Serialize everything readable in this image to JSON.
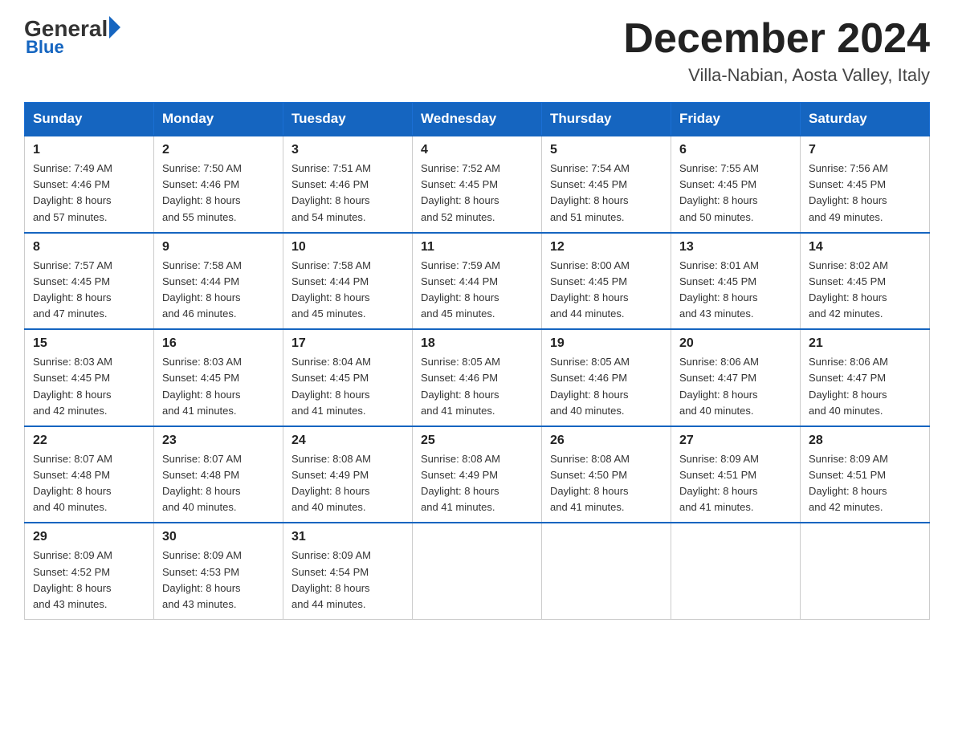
{
  "header": {
    "logo_general": "General",
    "logo_blue": "Blue",
    "month_title": "December 2024",
    "location": "Villa-Nabian, Aosta Valley, Italy"
  },
  "weekdays": [
    "Sunday",
    "Monday",
    "Tuesday",
    "Wednesday",
    "Thursday",
    "Friday",
    "Saturday"
  ],
  "weeks": [
    [
      {
        "day": 1,
        "sunrise": "7:49 AM",
        "sunset": "4:46 PM",
        "daylight": "8 hours and 57 minutes."
      },
      {
        "day": 2,
        "sunrise": "7:50 AM",
        "sunset": "4:46 PM",
        "daylight": "8 hours and 55 minutes."
      },
      {
        "day": 3,
        "sunrise": "7:51 AM",
        "sunset": "4:46 PM",
        "daylight": "8 hours and 54 minutes."
      },
      {
        "day": 4,
        "sunrise": "7:52 AM",
        "sunset": "4:45 PM",
        "daylight": "8 hours and 52 minutes."
      },
      {
        "day": 5,
        "sunrise": "7:54 AM",
        "sunset": "4:45 PM",
        "daylight": "8 hours and 51 minutes."
      },
      {
        "day": 6,
        "sunrise": "7:55 AM",
        "sunset": "4:45 PM",
        "daylight": "8 hours and 50 minutes."
      },
      {
        "day": 7,
        "sunrise": "7:56 AM",
        "sunset": "4:45 PM",
        "daylight": "8 hours and 49 minutes."
      }
    ],
    [
      {
        "day": 8,
        "sunrise": "7:57 AM",
        "sunset": "4:45 PM",
        "daylight": "8 hours and 47 minutes."
      },
      {
        "day": 9,
        "sunrise": "7:58 AM",
        "sunset": "4:44 PM",
        "daylight": "8 hours and 46 minutes."
      },
      {
        "day": 10,
        "sunrise": "7:58 AM",
        "sunset": "4:44 PM",
        "daylight": "8 hours and 45 minutes."
      },
      {
        "day": 11,
        "sunrise": "7:59 AM",
        "sunset": "4:44 PM",
        "daylight": "8 hours and 45 minutes."
      },
      {
        "day": 12,
        "sunrise": "8:00 AM",
        "sunset": "4:45 PM",
        "daylight": "8 hours and 44 minutes."
      },
      {
        "day": 13,
        "sunrise": "8:01 AM",
        "sunset": "4:45 PM",
        "daylight": "8 hours and 43 minutes."
      },
      {
        "day": 14,
        "sunrise": "8:02 AM",
        "sunset": "4:45 PM",
        "daylight": "8 hours and 42 minutes."
      }
    ],
    [
      {
        "day": 15,
        "sunrise": "8:03 AM",
        "sunset": "4:45 PM",
        "daylight": "8 hours and 42 minutes."
      },
      {
        "day": 16,
        "sunrise": "8:03 AM",
        "sunset": "4:45 PM",
        "daylight": "8 hours and 41 minutes."
      },
      {
        "day": 17,
        "sunrise": "8:04 AM",
        "sunset": "4:45 PM",
        "daylight": "8 hours and 41 minutes."
      },
      {
        "day": 18,
        "sunrise": "8:05 AM",
        "sunset": "4:46 PM",
        "daylight": "8 hours and 41 minutes."
      },
      {
        "day": 19,
        "sunrise": "8:05 AM",
        "sunset": "4:46 PM",
        "daylight": "8 hours and 40 minutes."
      },
      {
        "day": 20,
        "sunrise": "8:06 AM",
        "sunset": "4:47 PM",
        "daylight": "8 hours and 40 minutes."
      },
      {
        "day": 21,
        "sunrise": "8:06 AM",
        "sunset": "4:47 PM",
        "daylight": "8 hours and 40 minutes."
      }
    ],
    [
      {
        "day": 22,
        "sunrise": "8:07 AM",
        "sunset": "4:48 PM",
        "daylight": "8 hours and 40 minutes."
      },
      {
        "day": 23,
        "sunrise": "8:07 AM",
        "sunset": "4:48 PM",
        "daylight": "8 hours and 40 minutes."
      },
      {
        "day": 24,
        "sunrise": "8:08 AM",
        "sunset": "4:49 PM",
        "daylight": "8 hours and 40 minutes."
      },
      {
        "day": 25,
        "sunrise": "8:08 AM",
        "sunset": "4:49 PM",
        "daylight": "8 hours and 41 minutes."
      },
      {
        "day": 26,
        "sunrise": "8:08 AM",
        "sunset": "4:50 PM",
        "daylight": "8 hours and 41 minutes."
      },
      {
        "day": 27,
        "sunrise": "8:09 AM",
        "sunset": "4:51 PM",
        "daylight": "8 hours and 41 minutes."
      },
      {
        "day": 28,
        "sunrise": "8:09 AM",
        "sunset": "4:51 PM",
        "daylight": "8 hours and 42 minutes."
      }
    ],
    [
      {
        "day": 29,
        "sunrise": "8:09 AM",
        "sunset": "4:52 PM",
        "daylight": "8 hours and 43 minutes."
      },
      {
        "day": 30,
        "sunrise": "8:09 AM",
        "sunset": "4:53 PM",
        "daylight": "8 hours and 43 minutes."
      },
      {
        "day": 31,
        "sunrise": "8:09 AM",
        "sunset": "4:54 PM",
        "daylight": "8 hours and 44 minutes."
      },
      null,
      null,
      null,
      null
    ]
  ]
}
